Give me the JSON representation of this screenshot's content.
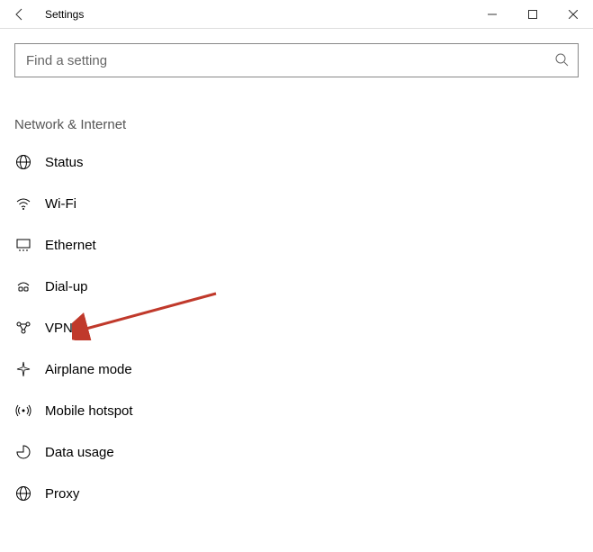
{
  "window": {
    "title": "Settings"
  },
  "search": {
    "placeholder": "Find a setting",
    "value": ""
  },
  "section": {
    "title": "Network & Internet"
  },
  "nav": {
    "items": [
      {
        "id": "status",
        "label": "Status",
        "icon": "status-icon"
      },
      {
        "id": "wifi",
        "label": "Wi-Fi",
        "icon": "wifi-icon"
      },
      {
        "id": "ethernet",
        "label": "Ethernet",
        "icon": "ethernet-icon"
      },
      {
        "id": "dialup",
        "label": "Dial-up",
        "icon": "dialup-icon"
      },
      {
        "id": "vpn",
        "label": "VPN",
        "icon": "vpn-icon"
      },
      {
        "id": "airplane",
        "label": "Airplane mode",
        "icon": "airplane-icon"
      },
      {
        "id": "hotspot",
        "label": "Mobile hotspot",
        "icon": "hotspot-icon"
      },
      {
        "id": "datausage",
        "label": "Data usage",
        "icon": "datausage-icon"
      },
      {
        "id": "proxy",
        "label": "Proxy",
        "icon": "proxy-icon"
      }
    ]
  },
  "annotation": {
    "points_to": "vpn"
  }
}
